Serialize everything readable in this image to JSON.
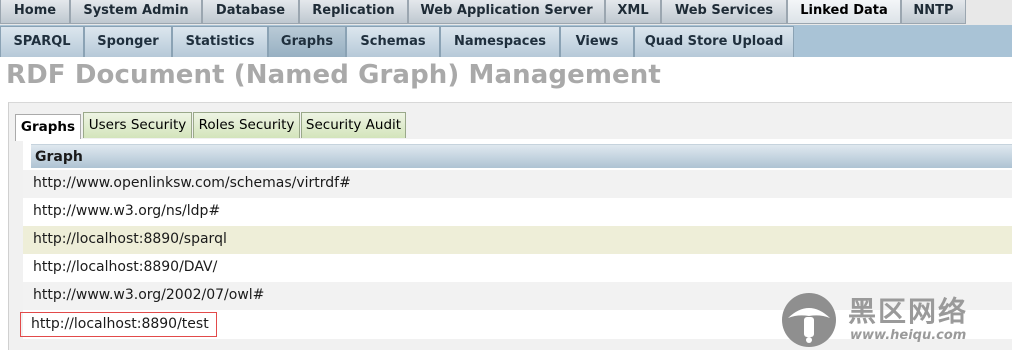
{
  "nav_primary": [
    {
      "label": "Home",
      "active": false
    },
    {
      "label": "System Admin",
      "active": false
    },
    {
      "label": "Database",
      "active": false
    },
    {
      "label": "Replication",
      "active": false
    },
    {
      "label": "Web Application Server",
      "active": false
    },
    {
      "label": "XML",
      "active": false
    },
    {
      "label": "Web Services",
      "active": false
    },
    {
      "label": "Linked Data",
      "active": true
    },
    {
      "label": "NNTP",
      "active": false
    }
  ],
  "nav_secondary": [
    {
      "label": "SPARQL",
      "active": false
    },
    {
      "label": "Sponger",
      "active": false
    },
    {
      "label": "Statistics",
      "active": false
    },
    {
      "label": "Graphs",
      "active": true
    },
    {
      "label": "Schemas",
      "active": false
    },
    {
      "label": "Namespaces",
      "active": false
    },
    {
      "label": "Views",
      "active": false
    },
    {
      "label": "Quad Store Upload",
      "active": false
    }
  ],
  "page_title": "RDF Document (Named Graph) Management",
  "subtabs": [
    {
      "label": "Graphs",
      "active": true
    },
    {
      "label": "Users Security",
      "active": false
    },
    {
      "label": "Roles Security",
      "active": false
    },
    {
      "label": "Security Audit",
      "active": false
    }
  ],
  "graph_table": {
    "header": "Graph",
    "rows": [
      {
        "value": "http://www.openlinksw.com/schemas/virtrdf#"
      },
      {
        "value": "http://www.w3.org/ns/ldp#"
      },
      {
        "value": "http://localhost:8890/sparql"
      },
      {
        "value": "http://localhost:8890/DAV/"
      },
      {
        "value": "http://www.w3.org/2002/07/owl#"
      },
      {
        "value": "http://localhost:8890/test"
      }
    ]
  },
  "watermark": {
    "name": "黑区网络",
    "url": "www.heiqu.com"
  },
  "colors": {
    "nav_secondary_bg": "#a9c3d6",
    "title_gray": "#a9a9a9",
    "row_hover": "#eeeed8",
    "highlight_box": "#e24a4a"
  },
  "icons": {
    "watermark_logo": "mushroom-logo-icon"
  }
}
